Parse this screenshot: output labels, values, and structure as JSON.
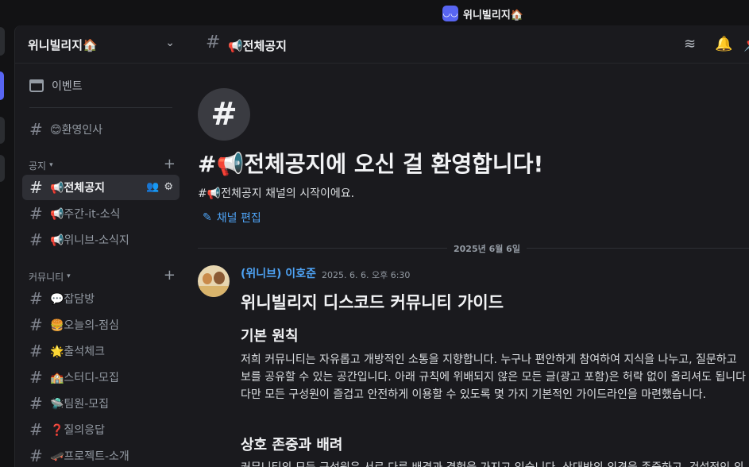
{
  "titlebar": {
    "app_icon": "discord-icon",
    "title": "위니빌리지🏠"
  },
  "sidebar": {
    "guild_name": "위니빌리지🏠",
    "events_label": "이벤트",
    "top_channels": [
      {
        "name": "😊환영인사"
      }
    ],
    "categories": [
      {
        "name": "공지",
        "channels": [
          {
            "name": "📢전체공지",
            "active": true
          },
          {
            "name": "📢주간-it-소식"
          },
          {
            "name": "📢위니브-소식지"
          }
        ]
      },
      {
        "name": "커뮤니티",
        "channels": [
          {
            "name": "💬잡담방"
          },
          {
            "name": "🍔오늘의-점심"
          },
          {
            "name": "🌟출석체크"
          },
          {
            "name": "🏫스터디-모집"
          },
          {
            "name": "🛸팀원-모집"
          },
          {
            "name": "❓질의응답"
          },
          {
            "name": "🛹프로젝트-소개"
          }
        ]
      }
    ]
  },
  "header": {
    "channel_name": "📢전체공지",
    "icons": [
      "threads-icon",
      "bell-icon",
      "pin-icon"
    ]
  },
  "welcome": {
    "title": "#📢전체공지에 오신 걸 환영합니다!",
    "subtitle": "#📢전체공지 채널의 시작이에요.",
    "edit_label": "채널 편집"
  },
  "date_divider": "2025년 6월 6일",
  "message": {
    "author": "(위니브) 이호준",
    "timestamp": "2025. 6. 6. 오후 6:30",
    "heading": "위니빌리지 디스코드 커뮤니티 가이드",
    "section1_title": "기본 원칙",
    "section1_lines": [
      "저희 커뮤니티는 자유롭고 개방적인 소통을 지향합니다. 누구나 편안하게 참여하여 지식을 나누고, 질문하고",
      "보를 공유할 수 있는 공간입니다. 아래 규칙에 위배되지 않은 모든 글(광고 포함)은 허락 없이 올리셔도 됩니다",
      "다만 모든 구성원이 즐겁고 안전하게 이용할 수 있도록 몇 가지 기본적인 가이드라인을 마련했습니다."
    ],
    "section2_title": "상호 존중과 배려",
    "section2_line": "커뮤니티의 모든 구성원은 서로 다른 배경과 경험을 가지고 있습니다. 상대방의 의견을 존중하고, 건설적인 의"
  }
}
